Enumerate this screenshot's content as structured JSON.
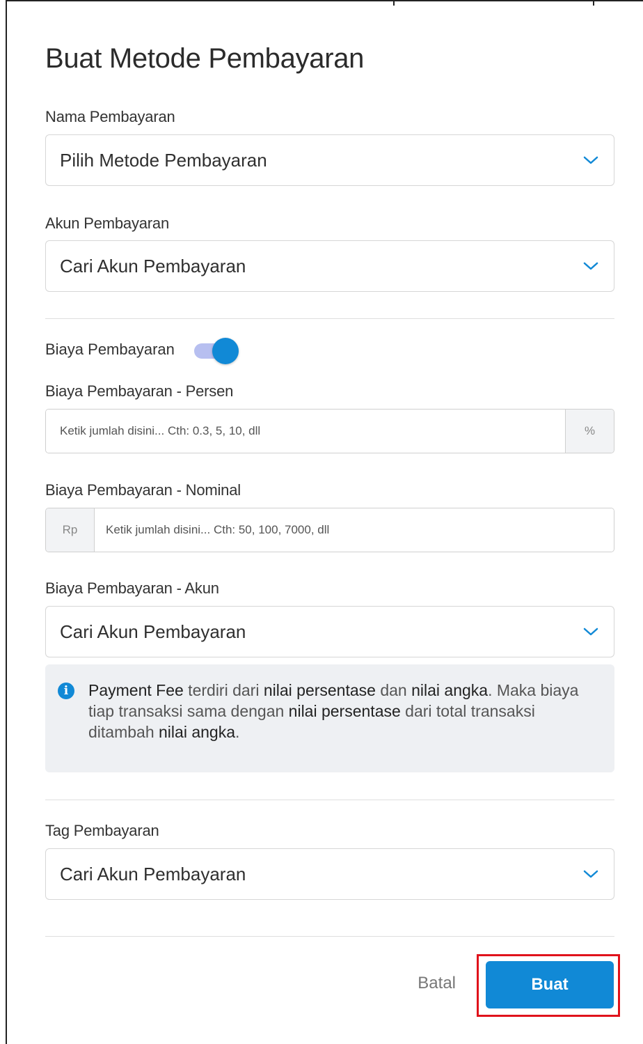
{
  "dialog": {
    "title": "Buat Metode Pembayaran"
  },
  "payment_name": {
    "label": "Nama Pembayaran",
    "value": "Pilih Metode Pembayaran"
  },
  "payment_account": {
    "label": "Akun Pembayaran",
    "value": "Cari Akun Pembayaran"
  },
  "payment_fee": {
    "label": "Biaya Pembayaran",
    "toggle_on": true
  },
  "fee_percent": {
    "label": "Biaya Pembayaran - Persen",
    "placeholder": "Ketik jumlah disini... Cth: 0.3, 5, 10, dll",
    "suffix": "%"
  },
  "fee_nominal": {
    "label": "Biaya Pembayaran - Nominal",
    "prefix": "Rp",
    "placeholder": "Ketik jumlah disini... Cth: 50, 100, 7000, dll"
  },
  "fee_account": {
    "label": "Biaya Pembayaran - Akun",
    "value": "Cari Akun Pembayaran"
  },
  "info": {
    "icon": "info-icon",
    "t1": "Payment Fee",
    "t2": " terdiri dari ",
    "t3": "nilai persentase",
    "t4": " dan ",
    "t5": "nilai angka",
    "t6": ". Maka biaya tiap transaksi sama dengan ",
    "t7": "nilai persentase",
    "t8": " dari total transaksi ditambah ",
    "t9": "nilai angka",
    "t10": "."
  },
  "payment_tag": {
    "label": "Tag Pembayaran",
    "value": "Cari Akun Pembayaran"
  },
  "actions": {
    "cancel_label": "Batal",
    "create_label": "Buat"
  },
  "colors": {
    "accent": "#1189d6",
    "highlight": "#e0121b"
  }
}
